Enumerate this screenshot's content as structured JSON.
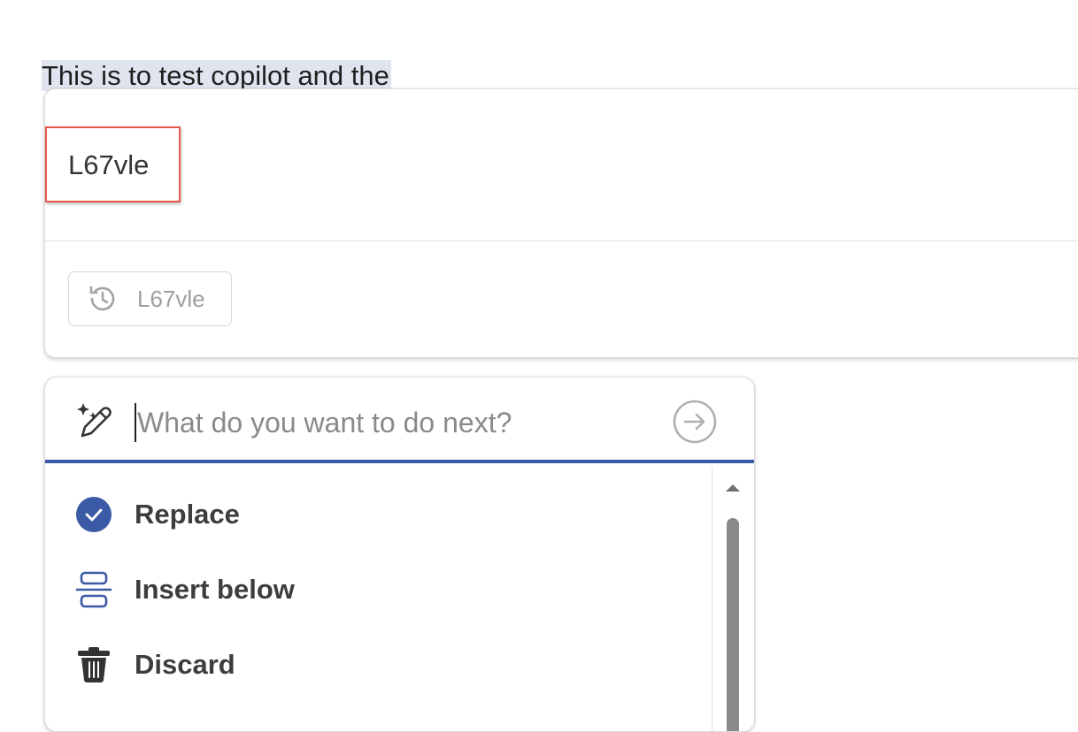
{
  "document": {
    "text": "This is to test copilot and the"
  },
  "result_card": {
    "generated_text": "L67vle",
    "history_chip_label": "L67vle"
  },
  "prompt": {
    "placeholder": "What do you want to do next?",
    "value": ""
  },
  "actions": [
    {
      "label": "Replace",
      "icon": "check-circle-icon"
    },
    {
      "label": "Insert below",
      "icon": "insert-below-icon"
    },
    {
      "label": "Discard",
      "icon": "trash-icon"
    }
  ],
  "colors": {
    "accent": "#3a5aa6",
    "highlight_box": "#e8584f",
    "selection": "#dfe4ee"
  }
}
